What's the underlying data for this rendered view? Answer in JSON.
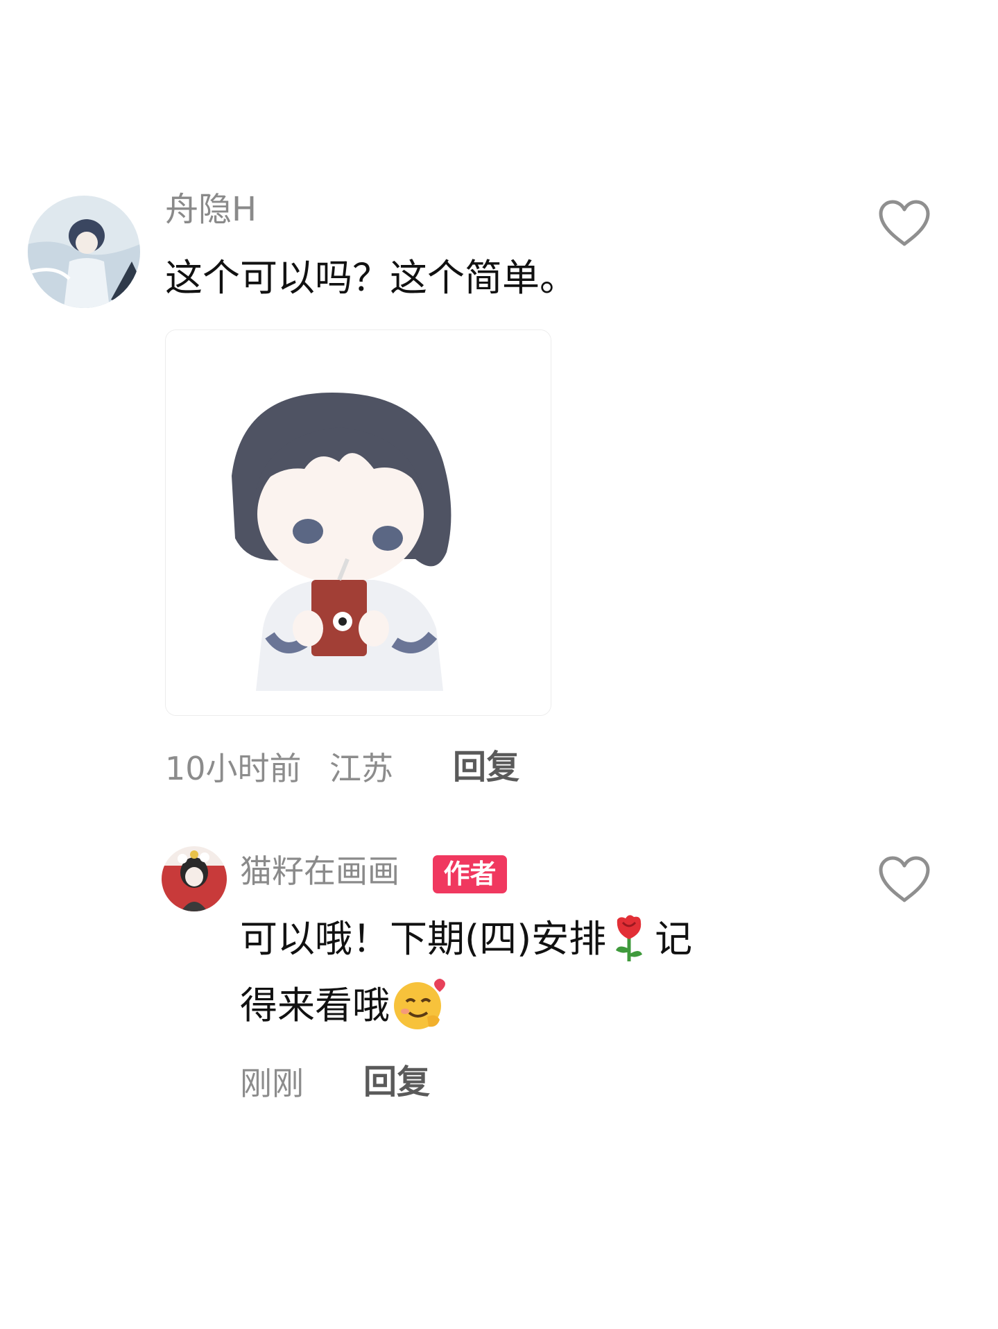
{
  "comments": [
    {
      "username": "舟隐H",
      "text": "这个可以吗？这个简单。",
      "time": "10小时前",
      "location": "江苏",
      "reply_label": "回复",
      "image_icon": "chibi-character-drinking-juice"
    },
    {
      "username": "猫籽在画画",
      "badge": "作者",
      "text_line1": "可以哦！下期(四)安排",
      "text_line1_tail": "记",
      "text_line2": "得来看哦",
      "time": "刚刚",
      "reply_label": "回复",
      "emojis": [
        "rose-emoji",
        "smiling-face-with-hearts-emoji"
      ]
    }
  ],
  "colors": {
    "badge_bg": "#f0385f",
    "username": "#8a8a8a",
    "meta": "#8c8c8c",
    "reply": "#5a5a5a"
  }
}
